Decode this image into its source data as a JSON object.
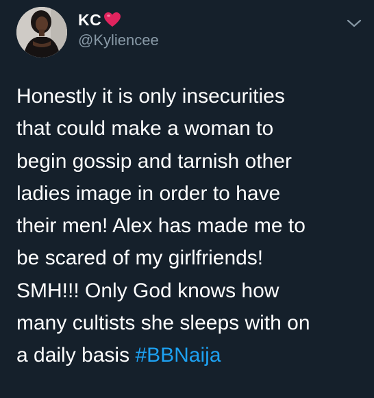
{
  "author": {
    "display_name": "KC",
    "emoji": "heart",
    "handle": "@Kyliencee"
  },
  "tweet": {
    "text": "Honestly it is only insecurities\nthat could make a woman to\nbegin gossip and tarnish other\nladies image in order to have\ntheir men! Alex has made me to\nbe scared of my girlfriends!\nSMH!!! Only God knows how\nmany cultists she sleeps with on\na daily basis ",
    "hashtag": "#BBNaija"
  },
  "icons": {
    "caret": "chevron-down-icon",
    "heart": "red-heart-emoji"
  },
  "colors": {
    "background": "#15202b",
    "secondary_text": "#8899a6",
    "link": "#1da1f2",
    "heart": "#e0245e"
  }
}
